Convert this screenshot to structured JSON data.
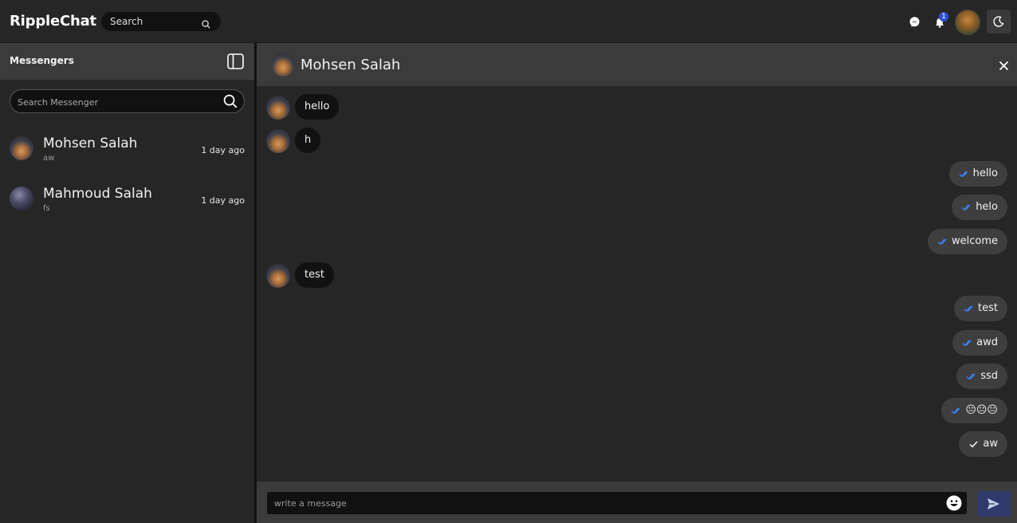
{
  "app": {
    "brand": "RippleChat",
    "search_placeholder": "Search"
  },
  "topbar": {
    "notification_count": "1",
    "icons": [
      "messenger-icon",
      "bell-icon",
      "user-avatar",
      "moon-icon"
    ]
  },
  "sidebar": {
    "title": "Messengers",
    "search_placeholder": "Search Messenger",
    "contacts": [
      {
        "name": "Mohsen Salah",
        "preview": "aw",
        "time": "1 day ago"
      },
      {
        "name": "Mahmoud Salah",
        "preview": "fs",
        "time": "1 day ago"
      }
    ]
  },
  "chat": {
    "title": "Mohsen Salah",
    "messages": [
      {
        "direction": "in",
        "text": "hello"
      },
      {
        "direction": "in",
        "text": "h"
      },
      {
        "direction": "out",
        "text": "hello",
        "status": "seen"
      },
      {
        "direction": "out",
        "text": "helo",
        "status": "seen"
      },
      {
        "direction": "out",
        "text": "welcome",
        "status": "seen"
      },
      {
        "direction": "in",
        "text": "test"
      },
      {
        "direction": "out",
        "text": "test",
        "status": "seen"
      },
      {
        "direction": "out",
        "text": "awd",
        "status": "seen"
      },
      {
        "direction": "out",
        "text": "ssd",
        "status": "seen"
      },
      {
        "direction": "out",
        "text": "😐😐😐",
        "status": "seen"
      },
      {
        "direction": "out",
        "text": "aw",
        "status": "sent"
      }
    ]
  },
  "composer": {
    "placeholder": "write a message"
  },
  "colors": {
    "background": "#262626",
    "header": "#3b3b3b",
    "bubble_in": "#111111",
    "bubble_out": "#3e3e3e",
    "seen_tick": "#3b82f6",
    "send_button": "#2f3a6a",
    "badge": "#2e4fd6"
  }
}
